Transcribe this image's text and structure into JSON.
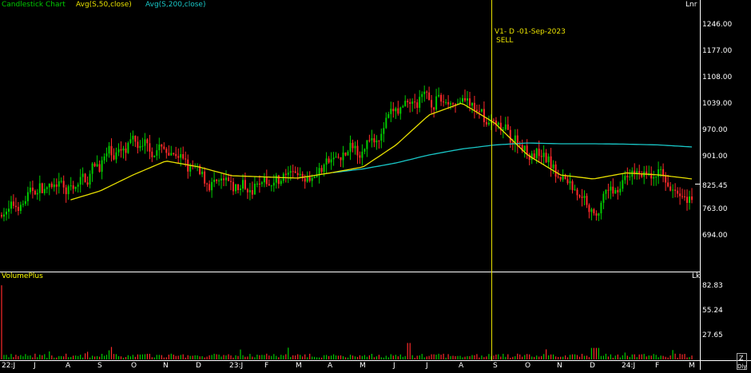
{
  "legend": {
    "chart_label": "Candlestick Chart",
    "ma50_label": "Avg(S,50,close)",
    "ma200_label": "Avg(S,200,close)"
  },
  "colors": {
    "background": "#000000",
    "candle_up": "#00cc00",
    "candle_down": "#ff2a2a",
    "ma50": "#e8e000",
    "ma200": "#19c8c8",
    "marker": "#e8e000",
    "axis_text": "#ffffff",
    "volume_label": "#ffff00",
    "chart_label": "#00cc00"
  },
  "price_panel": {
    "unit": "Lnr",
    "ticks": [
      "1246.00",
      "1177.00",
      "1108.00",
      "1039.00",
      "970.00",
      "901.00",
      "763.00",
      "694.00"
    ],
    "current_price": "825.45",
    "marker": {
      "text": "V1- D -01-Sep-2023",
      "signal": "SELL"
    }
  },
  "volume_panel": {
    "label": "VolumePlus",
    "unit": "Lk",
    "ticks": [
      "82.83",
      "55.24",
      "27.65"
    ]
  },
  "x_axis": {
    "labels": [
      "22:J",
      "J",
      "A",
      "S",
      "O",
      "N",
      "D",
      "23:J",
      "F",
      "M",
      "A",
      "M",
      "J",
      "J",
      "A",
      "S",
      "O",
      "N",
      "D",
      "24:J",
      "F",
      "M"
    ],
    "corner_top": "Z",
    "corner_bottom": "Dly"
  },
  "chart_data": {
    "type": "candlestick",
    "x_categories": [
      "22:J",
      "J",
      "A",
      "S",
      "O",
      "N",
      "D",
      "23:J",
      "F",
      "M",
      "A",
      "M",
      "J",
      "J",
      "A",
      "S",
      "O",
      "N",
      "D",
      "24:J",
      "F",
      "M"
    ],
    "ylim": [
      650,
      1290
    ],
    "series": [
      {
        "name": "Avg(S,50,close)",
        "values": [
          null,
          null,
          815,
          840,
          880,
          915,
          900,
          878,
          875,
          872,
          885,
          900,
          955,
          1030,
          1060,
          1010,
          930,
          880,
          870,
          885,
          880,
          870
        ]
      },
      {
        "name": "Avg(S,200,close)",
        "values": [
          null,
          null,
          null,
          null,
          null,
          null,
          null,
          null,
          null,
          null,
          885,
          895,
          910,
          930,
          945,
          955,
          960,
          958,
          958,
          957,
          955,
          950
        ]
      }
    ],
    "close": [
      780,
      850,
      830,
      920,
      960,
      940,
      870,
      840,
      870,
      880,
      910,
      960,
      1040,
      1070,
      1060,
      1000,
      940,
      880,
      790,
      890,
      870,
      830
    ],
    "volume_ylim": [
      0,
      95
    ]
  }
}
